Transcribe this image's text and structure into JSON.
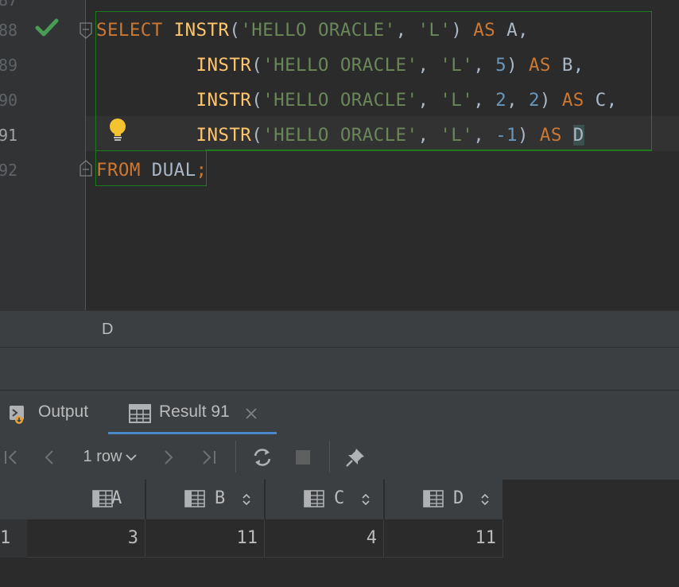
{
  "editor": {
    "partial_line_number": "87",
    "line_numbers": [
      "88",
      "89",
      "90",
      "91",
      "92"
    ],
    "current_line": "91",
    "code": {
      "line88": {
        "kw_select": "SELECT",
        "fn": "INSTR",
        "open": "(",
        "str1": "'HELLO ORACLE'",
        "comma1": ", ",
        "str2": "'L'",
        "close": ") ",
        "kw_as": "AS",
        "alias": " A,"
      },
      "line89": {
        "fn": "INSTR",
        "open": "(",
        "str1": "'HELLO ORACLE'",
        "comma1": ", ",
        "str2": "'L'",
        "comma2": ", ",
        "num1": "5",
        "close": ") ",
        "kw_as": "AS",
        "alias": " B,"
      },
      "line90": {
        "fn": "INSTR",
        "open": "(",
        "str1": "'HELLO ORACLE'",
        "comma1": ", ",
        "str2": "'L'",
        "comma2": ", ",
        "num1": "2",
        "comma3": ", ",
        "num2": "2",
        "close": ") ",
        "kw_as": "AS",
        "alias": " C,"
      },
      "line91": {
        "fn": "INSTR",
        "open": "(",
        "str1": "'HELLO ORACLE'",
        "comma1": ", ",
        "str2": "'L'",
        "comma2": ", ",
        "num1": "-1",
        "close": ") ",
        "kw_as": "AS",
        "space": " ",
        "alias": "D"
      },
      "line92": {
        "kw_from": "FROM",
        "table": " DUAL",
        "semi": ";"
      }
    }
  },
  "breadcrumb": {
    "item": "D"
  },
  "tabs": [
    {
      "label": "Output"
    },
    {
      "label": "Result 91"
    }
  ],
  "toolbar": {
    "rows_label": "1 row"
  },
  "grid": {
    "columns": [
      "A",
      "B",
      "C",
      "D"
    ],
    "rows": [
      {
        "row_number": "1",
        "values": [
          "3",
          "11",
          "4",
          "11"
        ]
      }
    ]
  },
  "colors": {
    "keyword": "#cc7832",
    "function": "#ffc66d",
    "string": "#6a8759",
    "number": "#6897bb",
    "selection_box": "#1d7a1d",
    "tab_underline": "#4a88c7"
  }
}
